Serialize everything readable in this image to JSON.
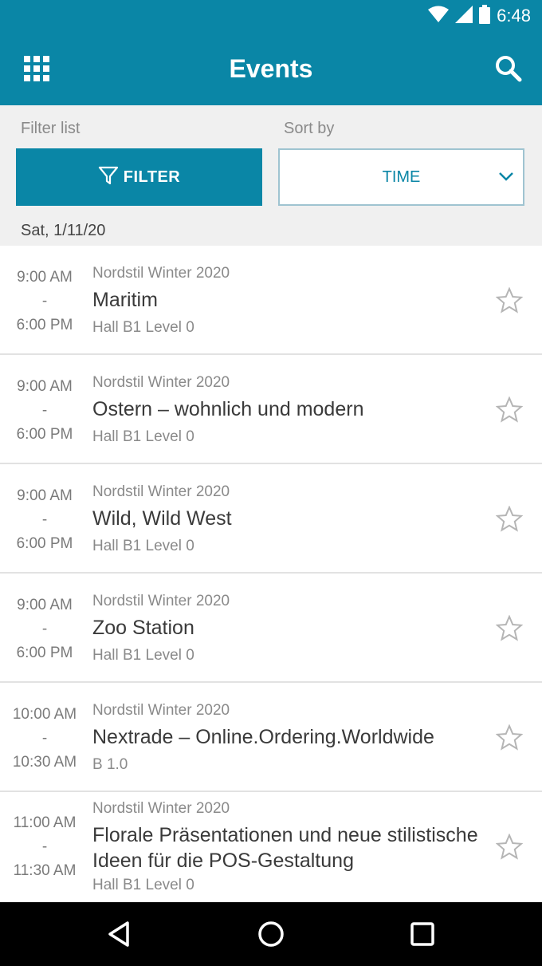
{
  "status_bar": {
    "time": "6:48"
  },
  "app_bar": {
    "title": "Events",
    "grid_icon": "grid-icon",
    "search_icon": "search-icon"
  },
  "filter": {
    "label": "Filter list",
    "button_label": "FILTER"
  },
  "sort": {
    "label": "Sort by",
    "value": "TIME"
  },
  "date_header": "Sat, 1/11/20",
  "events": [
    {
      "start": "9:00 AM",
      "sep": "-",
      "end": "6:00 PM",
      "series": "Nordstil Winter 2020",
      "title": "Maritim",
      "location": "Hall B1 Level 0"
    },
    {
      "start": "9:00 AM",
      "sep": "-",
      "end": "6:00 PM",
      "series": "Nordstil Winter 2020",
      "title": "Ostern – wohnlich und modern",
      "location": "Hall B1 Level 0"
    },
    {
      "start": "9:00 AM",
      "sep": "-",
      "end": "6:00 PM",
      "series": "Nordstil Winter 2020",
      "title": "Wild, Wild West",
      "location": "Hall B1 Level 0"
    },
    {
      "start": "9:00 AM",
      "sep": "-",
      "end": "6:00 PM",
      "series": "Nordstil Winter 2020",
      "title": "Zoo Station",
      "location": "Hall B1 Level 0"
    },
    {
      "start": "10:00 AM",
      "sep": "-",
      "end": "10:30 AM",
      "series": "Nordstil Winter 2020",
      "title": "Nextrade – Online.Ordering.Worldwide",
      "location": "B 1.0"
    },
    {
      "start": "11:00 AM",
      "sep": "-",
      "end": "11:30 AM",
      "series": "Nordstil Winter 2020",
      "title": "Florale Präsentationen und neue stilistische Ideen für die POS-Gestaltung",
      "location": "Hall B1 Level 0"
    }
  ],
  "colors": {
    "primary": "#0a86a6",
    "background": "#f0f0f0"
  }
}
